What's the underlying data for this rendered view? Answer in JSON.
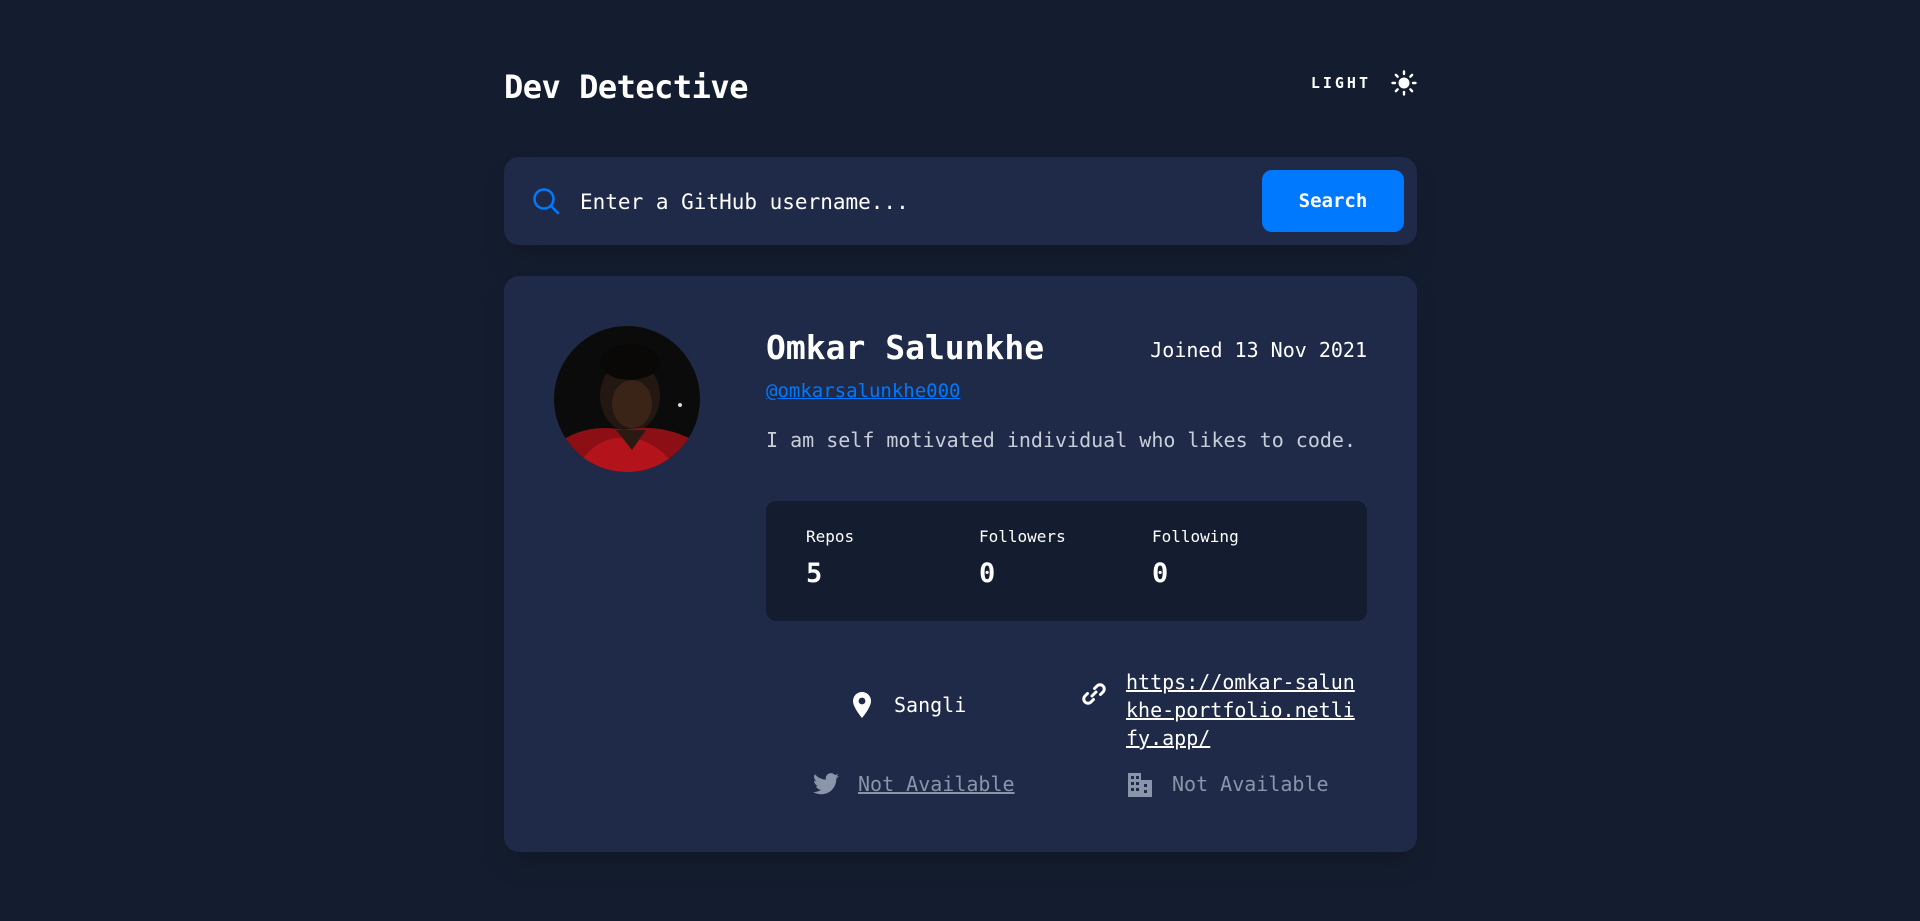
{
  "header": {
    "title": "Dev Detective",
    "theme_label": "LIGHT",
    "theme_icon": "sun-icon"
  },
  "search": {
    "placeholder": "Enter a GitHub username...",
    "button_label": "Search",
    "icon": "search-icon"
  },
  "profile": {
    "name": "Omkar Salunkhe",
    "joined": "Joined 13 Nov 2021",
    "handle": "@omkarsalunkhe000",
    "bio": "I am self motivated individual who likes to code.",
    "stats": {
      "repos_label": "Repos",
      "repos_value": "5",
      "followers_label": "Followers",
      "followers_value": "0",
      "following_label": "Following",
      "following_value": "0"
    },
    "info": {
      "location": "Sangli",
      "website": "https://omkar-salunkhe-portfolio.netlify.app/",
      "twitter": "Not Available",
      "company": "Not Available"
    }
  },
  "colors": {
    "background": "#141d2f",
    "card": "#1e2a47",
    "accent": "#0079ff",
    "muted": "#8a95aa"
  }
}
